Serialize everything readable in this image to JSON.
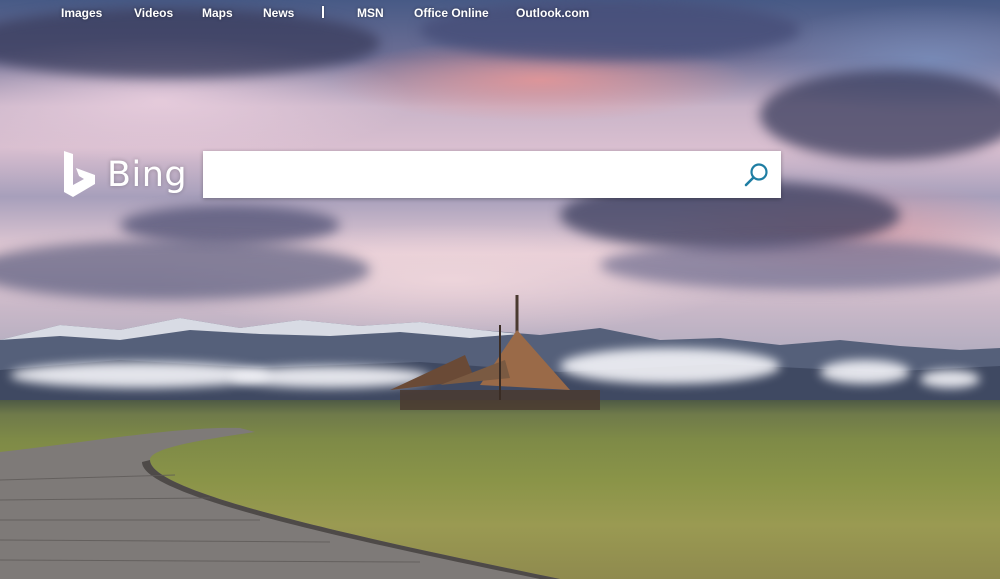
{
  "nav": {
    "links": [
      "Images",
      "Videos",
      "Maps",
      "News"
    ],
    "separator": "|",
    "services": [
      "MSN",
      "Office Online",
      "Outlook.com"
    ]
  },
  "logo": {
    "text": "Bing"
  },
  "search": {
    "value": "",
    "placeholder": ""
  },
  "colors": {
    "nav_text": "#ffffff",
    "search_icon": "#1f7ea3",
    "search_box": "#ffffff"
  },
  "icons": {
    "logo": "bing-logo-icon",
    "search": "search-icon"
  }
}
